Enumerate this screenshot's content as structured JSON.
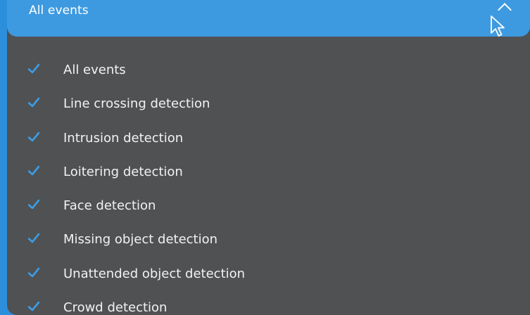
{
  "dropdown": {
    "selected_label": "All events",
    "expanded": true,
    "chevron_icon": "chevron-up-icon",
    "check_icon": "checkmark-icon",
    "options": [
      {
        "label": "All events",
        "checked": true
      },
      {
        "label": "Line crossing detection",
        "checked": true
      },
      {
        "label": "Intrusion detection",
        "checked": true
      },
      {
        "label": "Loitering detection",
        "checked": true
      },
      {
        "label": "Face detection",
        "checked": true
      },
      {
        "label": "Missing object detection",
        "checked": true
      },
      {
        "label": "Unattended object detection",
        "checked": true
      },
      {
        "label": "Crowd detection",
        "checked": true
      }
    ]
  },
  "colors": {
    "accent": "#3e9ae0",
    "panel": "#4f5153",
    "check": "#3c9de6",
    "text": "#f2f2f2"
  }
}
